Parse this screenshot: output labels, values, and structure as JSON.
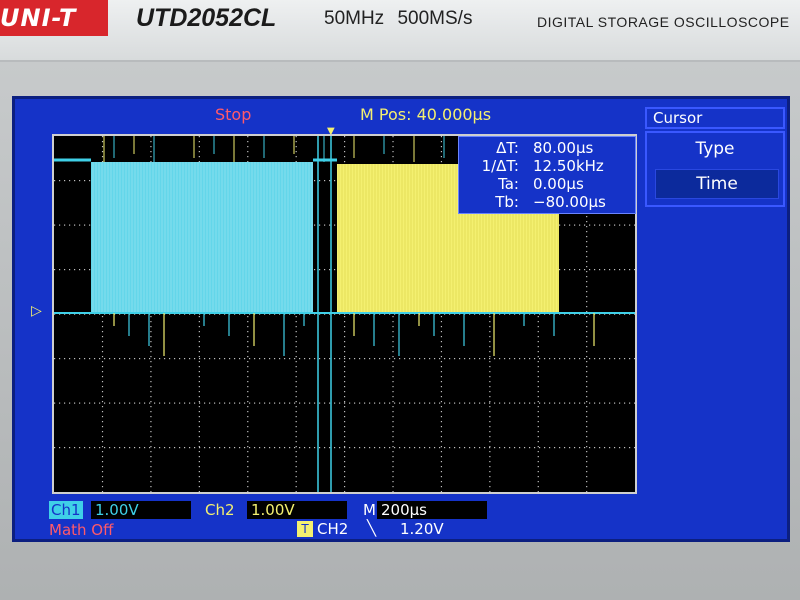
{
  "device": {
    "brand": "UNI-T",
    "model": "UTD2052CL",
    "specs": "50MHz 500MS/s",
    "subtitle": "DIGITAL STORAGE OSCILLOSCOPE"
  },
  "status": {
    "run_state": "Stop",
    "horizontal_position": "M Pos: 40.000µs"
  },
  "cursor_readout": {
    "rows": [
      {
        "label": "ΔT:",
        "value": "80.00µs"
      },
      {
        "label": "1/ΔT:",
        "value": "12.50kHz"
      },
      {
        "label": "Ta:",
        "value": "0.00µs"
      },
      {
        "label": "Tb:",
        "value": "−80.00µs"
      }
    ]
  },
  "menu": {
    "title": "Cursor",
    "type_label": "Type",
    "type_value": "Time"
  },
  "bottom": {
    "ch1_tag": "Ch1",
    "ch1_scale": "1.00V",
    "ch2_tag": "Ch2",
    "ch2_scale": "1.00V",
    "timebase_tag": "M",
    "timebase": "200µs",
    "math": "Math Off",
    "trigger_source": "CH2",
    "trigger_slope": "╲",
    "trigger_level": "1.20V"
  },
  "colors": {
    "ch1": "#3fd0e8",
    "ch2": "#f4f070",
    "screen": "#1533c8",
    "alert": "#ff5a6a"
  },
  "icons": {
    "trigger": "trigger-icon",
    "trigger_position_marker": "trigger-position-marker-icon",
    "channel_ground_marker": "channel-ground-marker-icon",
    "trigger_level_marker": "trigger-level-marker-icon"
  }
}
